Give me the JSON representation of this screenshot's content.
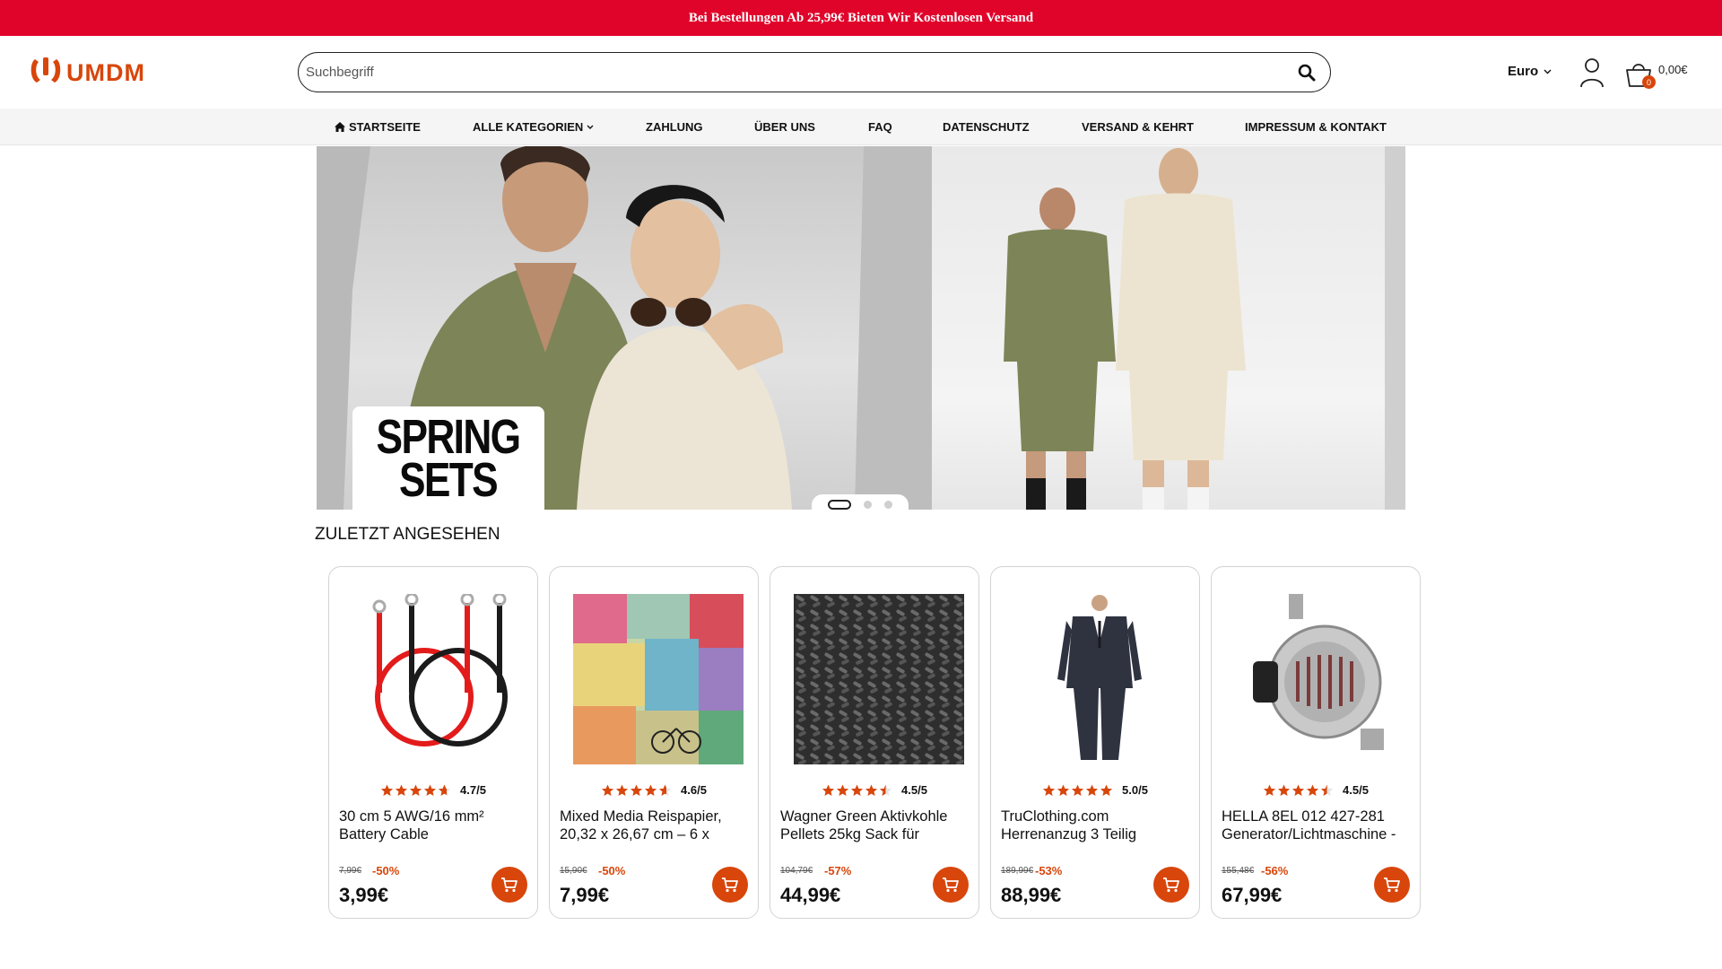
{
  "promo": {
    "text": "Bei Bestellungen Ab 25,99€ Bieten Wir Kostenlosen Versand"
  },
  "header": {
    "logo_text": "UMDM",
    "search_placeholder": "Suchbegriff",
    "currency": "Euro",
    "cart_count": "0",
    "cart_total": "0,00€"
  },
  "nav": {
    "items": [
      {
        "label": "STARTSEITE",
        "icon": "home-icon"
      },
      {
        "label": "ALLE KATEGORIEN",
        "icon": "chevron-down-icon"
      },
      {
        "label": "ZAHLUNG"
      },
      {
        "label": "ÜBER UNS"
      },
      {
        "label": "FAQ"
      },
      {
        "label": "DATENSCHUTZ"
      },
      {
        "label": "VERSAND & KEHRT"
      },
      {
        "label": "IMPRESSUM & KONTAKT"
      }
    ]
  },
  "hero": {
    "headline_line1": "SPRING",
    "headline_line2": "SETS",
    "slide_count": 3,
    "active_slide": 1
  },
  "recent": {
    "title": "ZULETZT ANGESEHEN",
    "products": [
      {
        "rating": "4.7/5",
        "stars": 4.7,
        "title": "30 cm 5 AWG/16 mm² Battery Cable",
        "old_price": "7,99€",
        "discount": "-50%",
        "price": "3,99€"
      },
      {
        "rating": "4.6/5",
        "stars": 4.6,
        "title": "Mixed Media Reispapier, 20,32 x 26,67 cm – 6 x",
        "old_price": "15,90€",
        "discount": "-50%",
        "price": "7,99€"
      },
      {
        "rating": "4.5/5",
        "stars": 4.5,
        "title": "Wagner Green Aktivkohle Pellets 25kg Sack für",
        "old_price": "104,79€",
        "discount": "-57%",
        "price": "44,99€"
      },
      {
        "rating": "5.0/5",
        "stars": 5.0,
        "title": "TruClothing.com Herrenanzug 3 Teilig",
        "old_price": "189,99€",
        "discount": "-53%",
        "price": "88,99€"
      },
      {
        "rating": "4.5/5",
        "stars": 4.5,
        "title": "HELLA 8EL 012 427-281 Generator/Lichtmaschine -",
        "old_price": "155,48€",
        "discount": "-56%",
        "price": "67,99€"
      }
    ]
  },
  "colors": {
    "brand": "#d8460b",
    "promo_bg": "#e0032a"
  }
}
